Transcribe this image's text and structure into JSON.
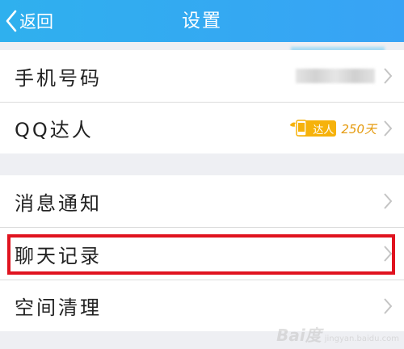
{
  "header": {
    "back_label": "返回",
    "title": "设置"
  },
  "settings_group_1": [
    {
      "label": "手机号码",
      "value": ""
    },
    {
      "label": "QQ达人",
      "badge_text": "达人",
      "days": "250天"
    }
  ],
  "settings_group_2": [
    {
      "label": "消息通知"
    },
    {
      "label": "聊天记录"
    },
    {
      "label": "空间清理"
    }
  ],
  "watermark": {
    "logo": "Bai度",
    "sub": "jingyan.baidu.com"
  },
  "colors": {
    "header": "#2fb0ee",
    "highlight": "#e0131f",
    "badge": "#f6b20b",
    "background": "#eeeff3"
  },
  "icons": {
    "back": "chevron-left-icon",
    "row": "chevron-right-icon",
    "badge": "winged-phone-icon"
  }
}
